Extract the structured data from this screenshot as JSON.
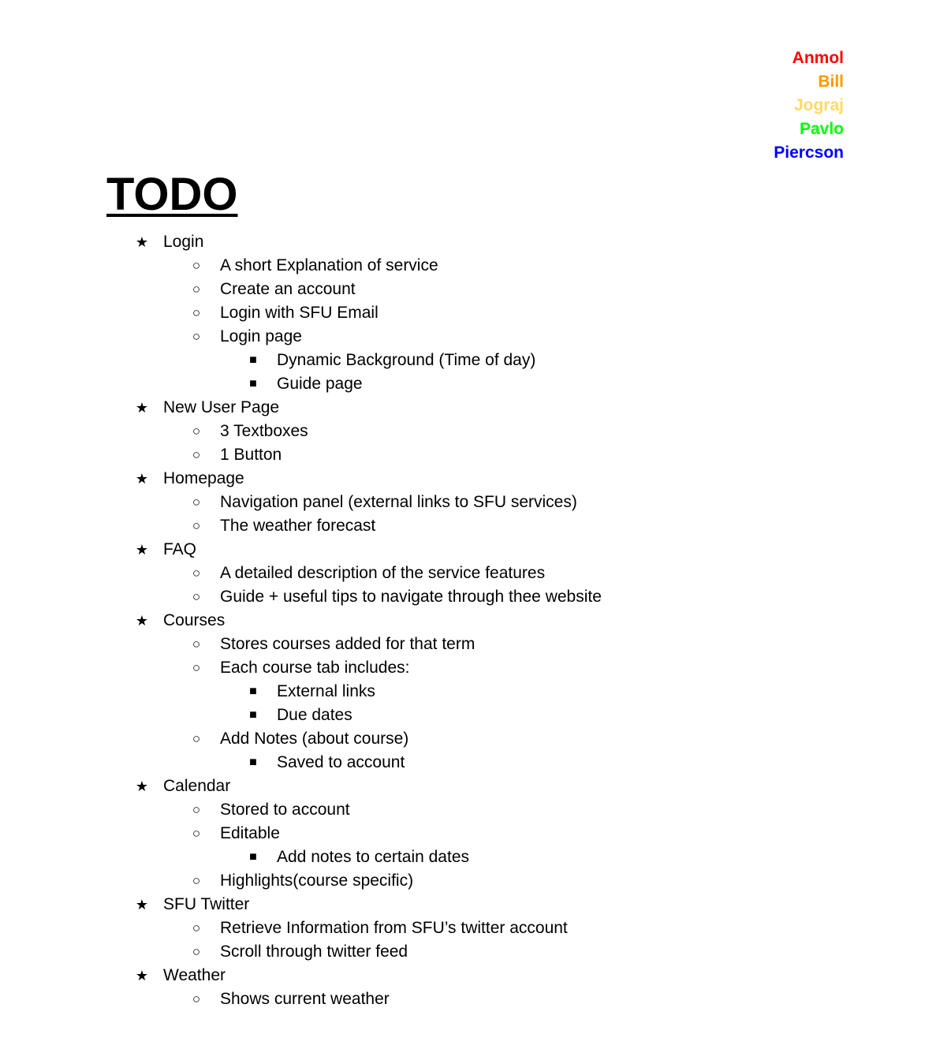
{
  "members": [
    {
      "name": "Anmol",
      "color": "#ff0000"
    },
    {
      "name": "Bill",
      "color": "#ff9900"
    },
    {
      "name": "Jograj",
      "color": "#ffd966"
    },
    {
      "name": "Pavlo",
      "color": "#00ff00"
    },
    {
      "name": "Piercson",
      "color": "#0000ff"
    }
  ],
  "title": "TODO",
  "bullets": {
    "level0": "★",
    "level1": "○",
    "level2": "■"
  },
  "items": [
    {
      "level": 0,
      "text": "Login"
    },
    {
      "level": 1,
      "text": "A short Explanation of service"
    },
    {
      "level": 1,
      "text": "Create an account"
    },
    {
      "level": 1,
      "text": "Login with SFU Email"
    },
    {
      "level": 1,
      "text": "Login page"
    },
    {
      "level": 2,
      "text": "Dynamic Background (Time of day)"
    },
    {
      "level": 2,
      "text": "Guide page"
    },
    {
      "level": 0,
      "text": "New User Page"
    },
    {
      "level": 1,
      "text": "3 Textboxes"
    },
    {
      "level": 1,
      "text": "1 Button"
    },
    {
      "level": 0,
      "text": "Homepage"
    },
    {
      "level": 1,
      "text": "Navigation panel (external links to SFU services)"
    },
    {
      "level": 1,
      "text": "The weather forecast"
    },
    {
      "level": 0,
      "text": "FAQ"
    },
    {
      "level": 1,
      "text": "A detailed description of the service features"
    },
    {
      "level": 1,
      "text": "Guide + useful tips to navigate through thee website"
    },
    {
      "level": 0,
      "text": "Courses"
    },
    {
      "level": 1,
      "text": "Stores courses added for that term"
    },
    {
      "level": 1,
      "text": "Each course tab includes:"
    },
    {
      "level": 2,
      "text": "External links"
    },
    {
      "level": 2,
      "text": "Due dates"
    },
    {
      "level": 1,
      "text": "Add Notes (about course)"
    },
    {
      "level": 2,
      "text": "Saved to account"
    },
    {
      "level": 0,
      "text": "Calendar"
    },
    {
      "level": 1,
      "text": "Stored to account"
    },
    {
      "level": 1,
      "text": "Editable"
    },
    {
      "level": 2,
      "text": "Add notes to certain dates"
    },
    {
      "level": 1,
      "text": "Highlights(course specific)"
    },
    {
      "level": 0,
      "text": "SFU Twitter"
    },
    {
      "level": 1,
      "text": "Retrieve Information from SFU’s twitter account"
    },
    {
      "level": 1,
      "text": "Scroll through twitter feed"
    },
    {
      "level": 0,
      "text": "Weather"
    },
    {
      "level": 1,
      "text": "Shows current weather"
    }
  ]
}
